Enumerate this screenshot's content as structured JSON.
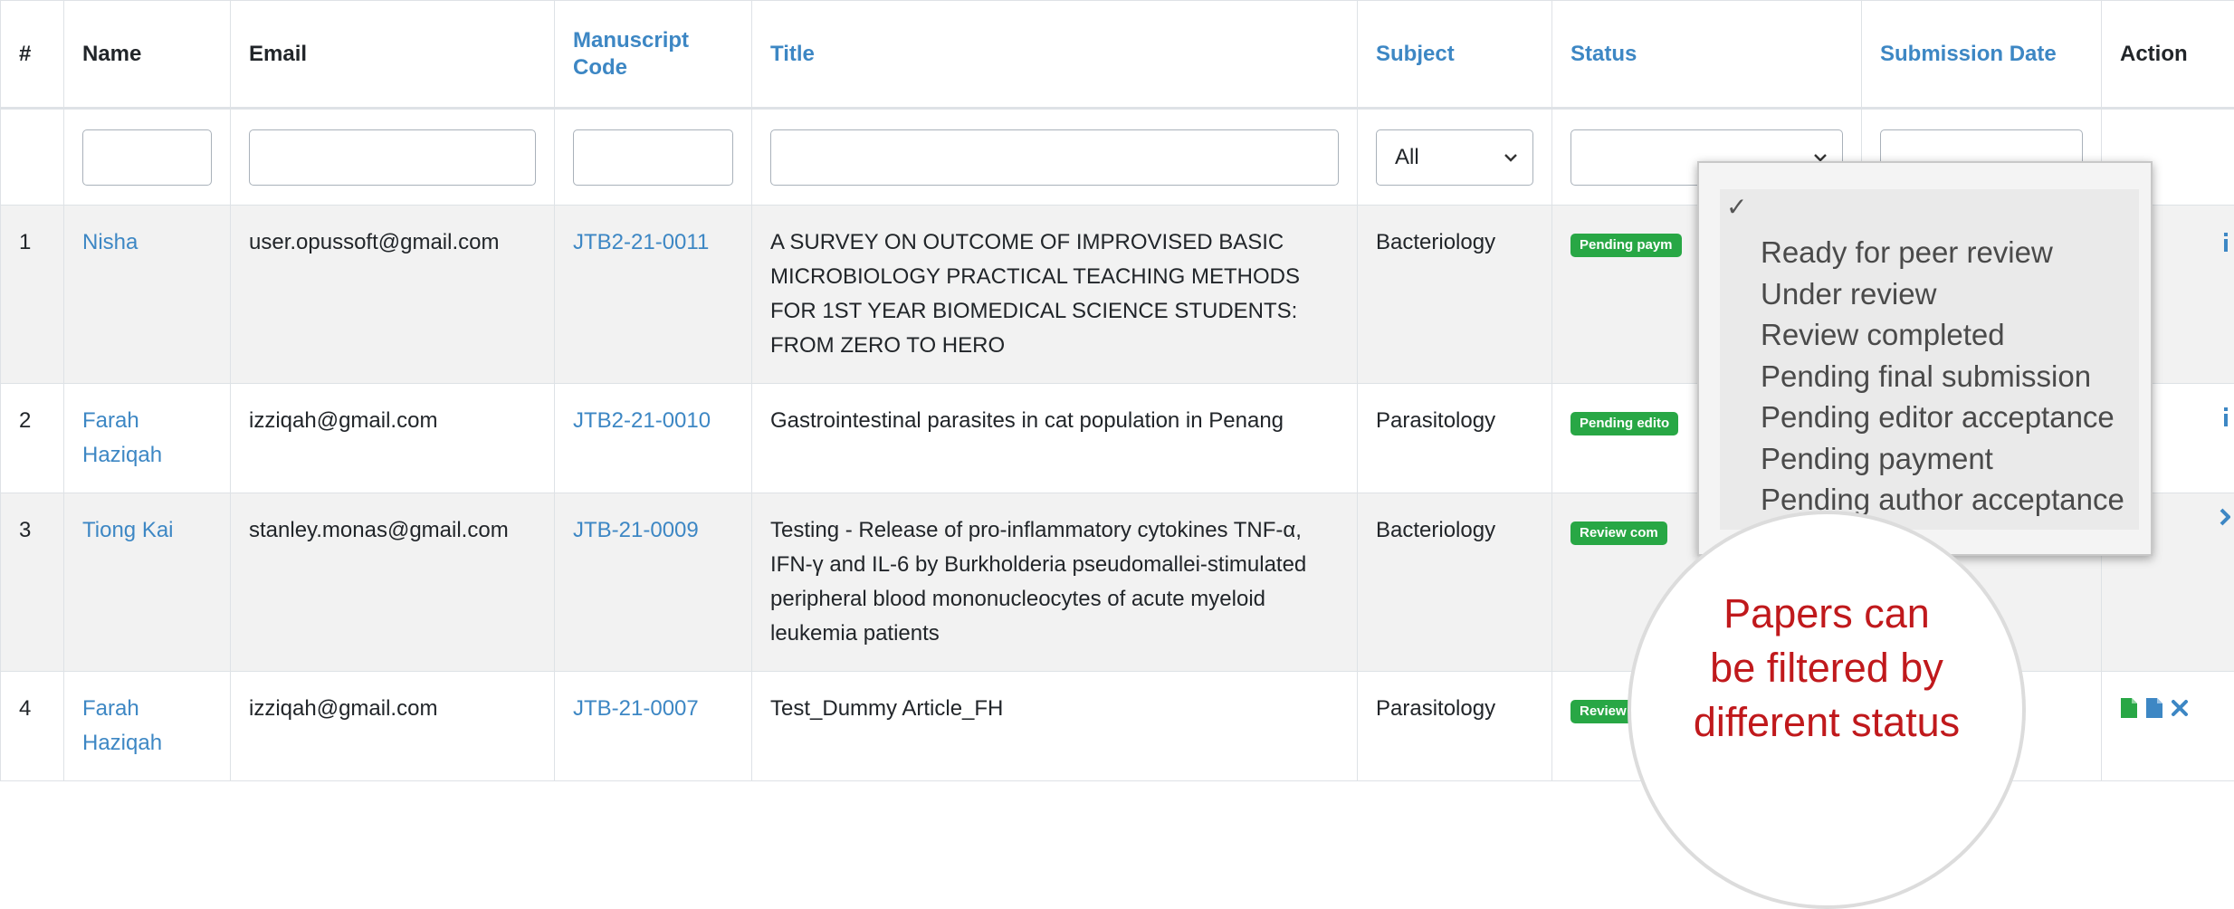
{
  "table": {
    "headers": {
      "index": "#",
      "name": "Name",
      "email": "Email",
      "manuscript_code": "Manuscript Code",
      "title": "Title",
      "subject": "Subject",
      "status": "Status",
      "submission_date": "Submission Date",
      "action": "Action"
    },
    "filters": {
      "name": "",
      "email": "",
      "manuscript_code": "",
      "title": "",
      "subject": "All",
      "status": "",
      "submission_date": ""
    },
    "rows": [
      {
        "index": "1",
        "name": "Nisha",
        "email": "user.opussoft@gmail.com",
        "code": "JTB2-21-0011",
        "title": "A SURVEY ON OUTCOME OF IMPROVISED BASIC MICROBIOLOGY PRACTICAL TEACHING METHODS FOR 1ST YEAR BIOMEDICAL SCIENCE STUDENTS: FROM ZERO TO HERO",
        "subject": "Bacteriology",
        "status": "Pending paym"
      },
      {
        "index": "2",
        "name": "Farah Haziqah",
        "email": "izziqah@gmail.com",
        "code": "JTB2-21-0010",
        "title": "Gastrointestinal parasites in cat population in Penang",
        "subject": "Parasitology",
        "status": "Pending edito"
      },
      {
        "index": "3",
        "name": "Tiong Kai",
        "email": "stanley.monas@gmail.com",
        "code": "JTB-21-0009",
        "title": "Testing - Release of pro-inflammatory cytokines TNF-α, IFN-γ and IL-6 by Burkholderia pseudomallei-stimulated peripheral blood mononucleocytes of acute myeloid leukemia patients",
        "subject": "Bacteriology",
        "status": "Review com"
      },
      {
        "index": "4",
        "name": "Farah Haziqah",
        "email": "izziqah@gmail.com",
        "code": "JTB-21-0007",
        "title": "Test_Dummy Article_FH",
        "subject": "Parasitology",
        "status": "Review"
      }
    ]
  },
  "status_dropdown": {
    "check_mark": "✓",
    "options": [
      "Ready for peer review",
      "Under review",
      "Review completed",
      "Pending final submission",
      "Pending editor acceptance",
      "Pending payment",
      "Pending author acceptance"
    ]
  },
  "callout": {
    "line1": "Papers can",
    "line2": "be filtered by",
    "line3": "different status"
  },
  "colors": {
    "link": "#3d87c4",
    "badge": "#28a745",
    "callout_text": "#c0191c",
    "row_shade": "#f2f2f2"
  },
  "icons": [
    "chevron-down-icon",
    "document-green-icon",
    "document-blue-icon",
    "delete-x-icon",
    "info-icon"
  ]
}
